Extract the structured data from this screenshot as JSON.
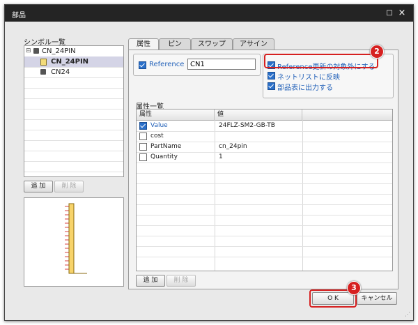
{
  "window": {
    "title": "部品",
    "restore_icon": "□",
    "close_icon": "×"
  },
  "symbols": {
    "label": "シンボル一覧",
    "tree": [
      {
        "label": "CN_24PIN",
        "level": 0,
        "icon": "component-icon",
        "expander": "⊟"
      },
      {
        "label": "CN_24PIN",
        "level": 1,
        "icon": "part-icon",
        "selected": true
      },
      {
        "label": "CN24",
        "level": 1,
        "icon": "component-icon"
      }
    ],
    "add_label": "追 加",
    "delete_label": "削 除"
  },
  "tabs": [
    {
      "label": "属性",
      "active": true
    },
    {
      "label": "ピン"
    },
    {
      "label": "スワップ"
    },
    {
      "label": "アサイン"
    }
  ],
  "reference": {
    "checkbox_label": "Reference",
    "checked": true,
    "value": "CN1"
  },
  "options": [
    {
      "label": "Reference更新の対象外にする",
      "checked": true
    },
    {
      "label": "ネットリストに反映",
      "checked": true
    },
    {
      "label": "部品表に出力する",
      "checked": true
    }
  ],
  "attributes": {
    "label": "属性一覧",
    "columns": [
      "属性",
      "値"
    ],
    "rows": [
      {
        "name": "Value",
        "checked": true,
        "value": "24FLZ-SM2-GB-TB"
      },
      {
        "name": "cost",
        "checked": false,
        "value": ""
      },
      {
        "name": "PartName",
        "checked": false,
        "value": "cn_24pin"
      },
      {
        "name": "Quantity",
        "checked": false,
        "value": "1"
      }
    ],
    "add_label": "追 加",
    "delete_label": "削 除"
  },
  "footer": {
    "ok_label": "O K",
    "cancel_label": "キャンセル"
  },
  "markers": {
    "step2": "2",
    "step3": "3"
  },
  "colors": {
    "accent": "#2160b8",
    "marker": "#d62020",
    "titlebar": "#242424"
  }
}
